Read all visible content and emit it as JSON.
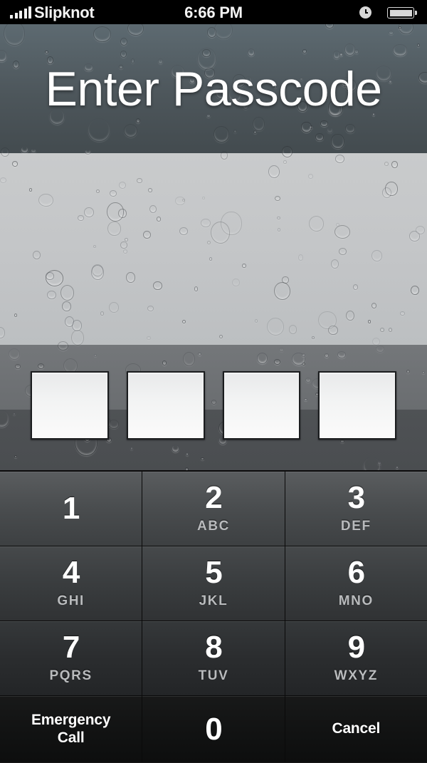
{
  "status_bar": {
    "signal_icon": "signal-bars-icon",
    "signal_bars_filled": 5,
    "signal_bars_total": 5,
    "carrier": "Slipknot",
    "time": "6:66 PM",
    "alarm_icon": "alarm-clock-icon",
    "battery_icon": "battery-icon",
    "battery_level_percent": 100
  },
  "lock_screen": {
    "title": "Enter Passcode",
    "passcode_length": 4,
    "passcode_entered": 0,
    "passcode_boxes": [
      "",
      "",
      "",
      ""
    ]
  },
  "keypad": {
    "rows": [
      [
        {
          "digit": "1",
          "letters": ""
        },
        {
          "digit": "2",
          "letters": "ABC"
        },
        {
          "digit": "3",
          "letters": "DEF"
        }
      ],
      [
        {
          "digit": "4",
          "letters": "GHI"
        },
        {
          "digit": "5",
          "letters": "JKL"
        },
        {
          "digit": "6",
          "letters": "MNO"
        }
      ],
      [
        {
          "digit": "7",
          "letters": "PQRS"
        },
        {
          "digit": "8",
          "letters": "TUV"
        },
        {
          "digit": "9",
          "letters": "WXYZ"
        }
      ]
    ],
    "bottom_row": {
      "emergency_call_line1": "Emergency",
      "emergency_call_line2": "Call",
      "zero": "0",
      "cancel": "Cancel"
    }
  },
  "colors": {
    "status_bar_bg": "#000000",
    "status_text": "#f4f4f4",
    "title_text": "#ffffff",
    "wallpaper_top": "#4d565b",
    "wallpaper_light": "#c3c5c7",
    "wallpaper_mid": "#6a6d70",
    "wallpaper_dark": "#4a4d50",
    "key_digit": "#ffffff",
    "key_letters": "#b9bbbd",
    "key_bg_dark": "#2b2d2f",
    "passcode_box_fill": "#f2f3f3",
    "passcode_box_border": "#1b1d1f"
  }
}
